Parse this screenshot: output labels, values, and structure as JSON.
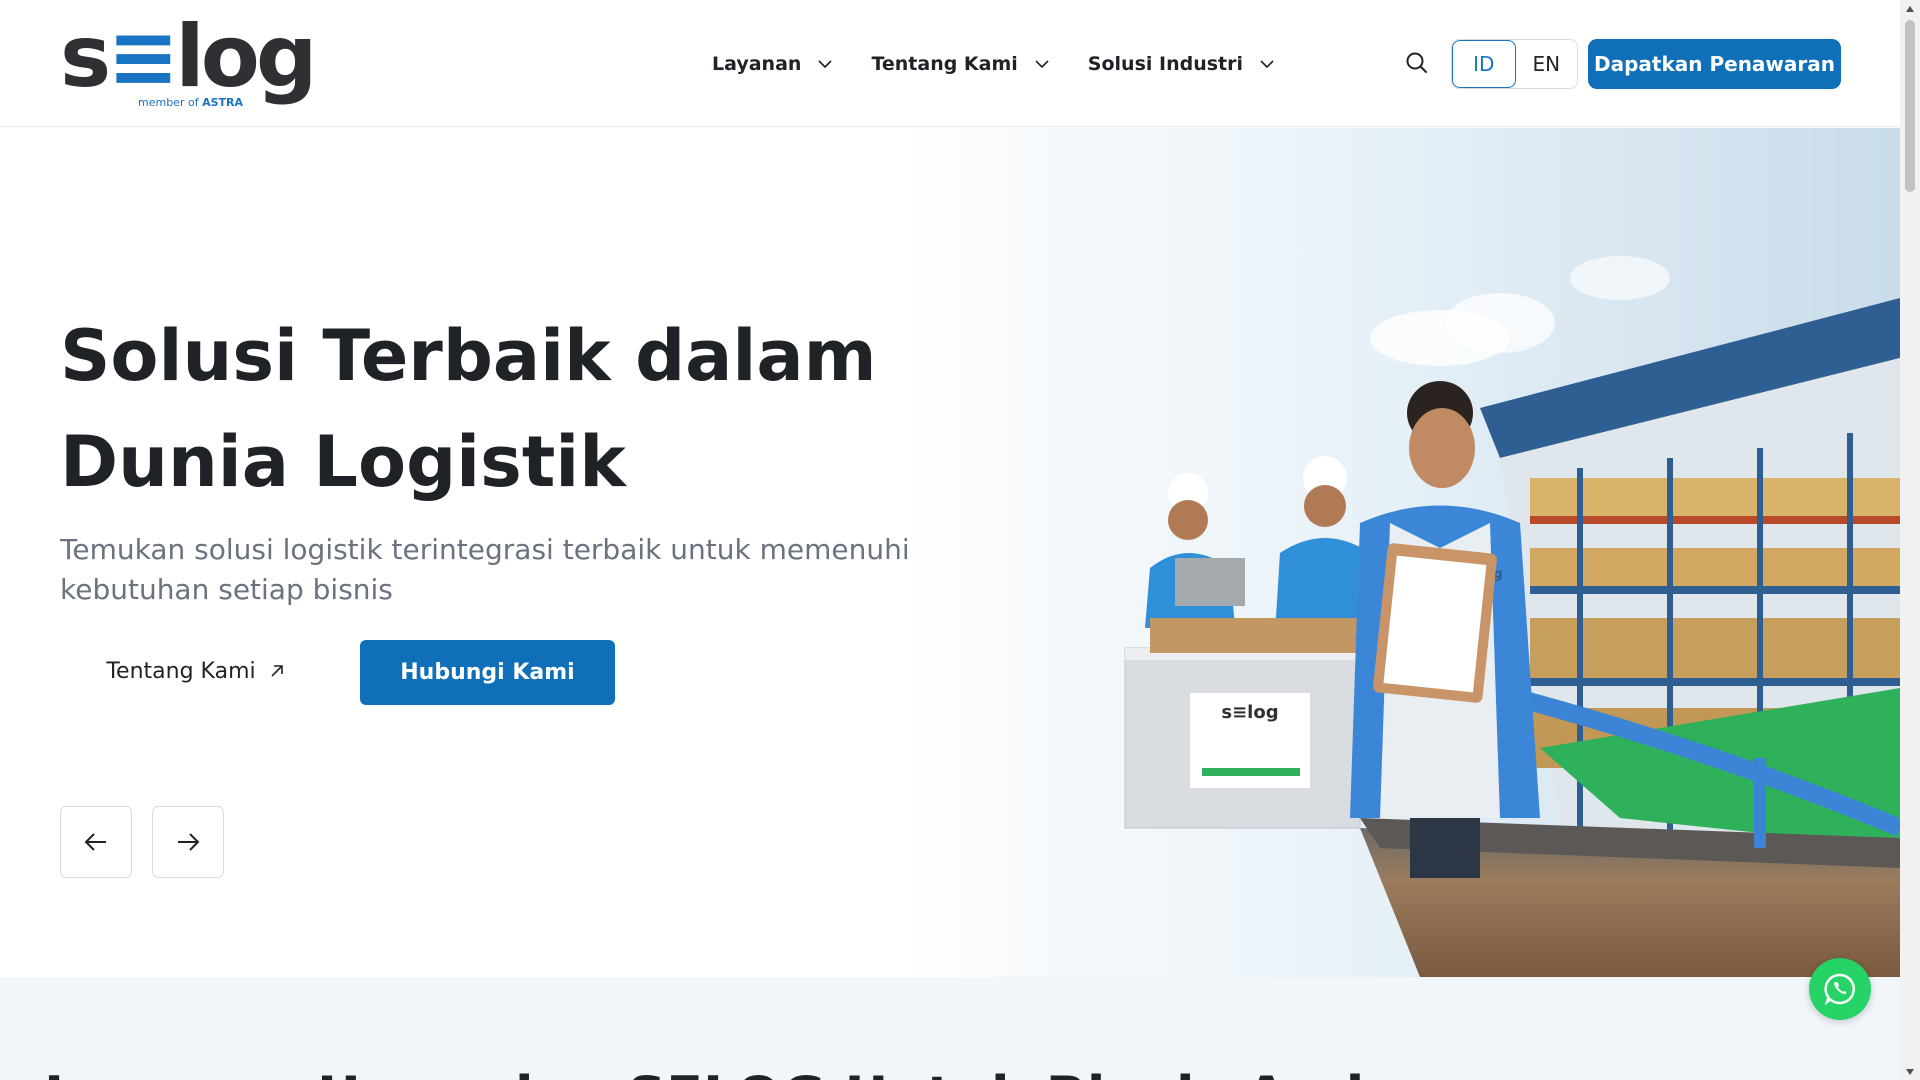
{
  "header": {
    "logo_text_s": "s",
    "logo_text_e": "≡",
    "logo_text_rest": "log",
    "logo_sub_prefix": "member of",
    "logo_sub_brand": "ASTRA",
    "nav": [
      {
        "label": "Layanan"
      },
      {
        "label": "Tentang Kami"
      },
      {
        "label": "Solusi Industri"
      }
    ],
    "lang": {
      "id": "ID",
      "en": "EN",
      "active": "ID"
    },
    "cta_label": "Dapatkan Penawaran"
  },
  "hero": {
    "title": "Solusi Terbaik dalam Dunia Logistik",
    "subtitle": "Temukan solusi logistik terintegrasi terbaik untuk memenuhi kebutuhan setiap bisnis",
    "secondary_button": "Tentang Kami",
    "primary_button": "Hubungi Kami",
    "illustration": {
      "uniform_logo": "s≡log",
      "screen_logo": "s≡log"
    }
  },
  "section2": {
    "title": "Layanan Unggulan SELOG Untuk Bisnis Anda"
  },
  "colors": {
    "primary": "#0f6fb8",
    "accent": "#1a74c4",
    "text": "#1f2328",
    "muted": "#6b7280",
    "whatsapp": "#25d366",
    "section_bg": "#f2f6fb"
  },
  "icons": {
    "search": "search-icon",
    "chevron": "chevron-down-icon",
    "external": "arrow-up-right-icon",
    "prev": "arrow-left-icon",
    "next": "arrow-right-icon",
    "whatsapp": "whatsapp-icon"
  }
}
